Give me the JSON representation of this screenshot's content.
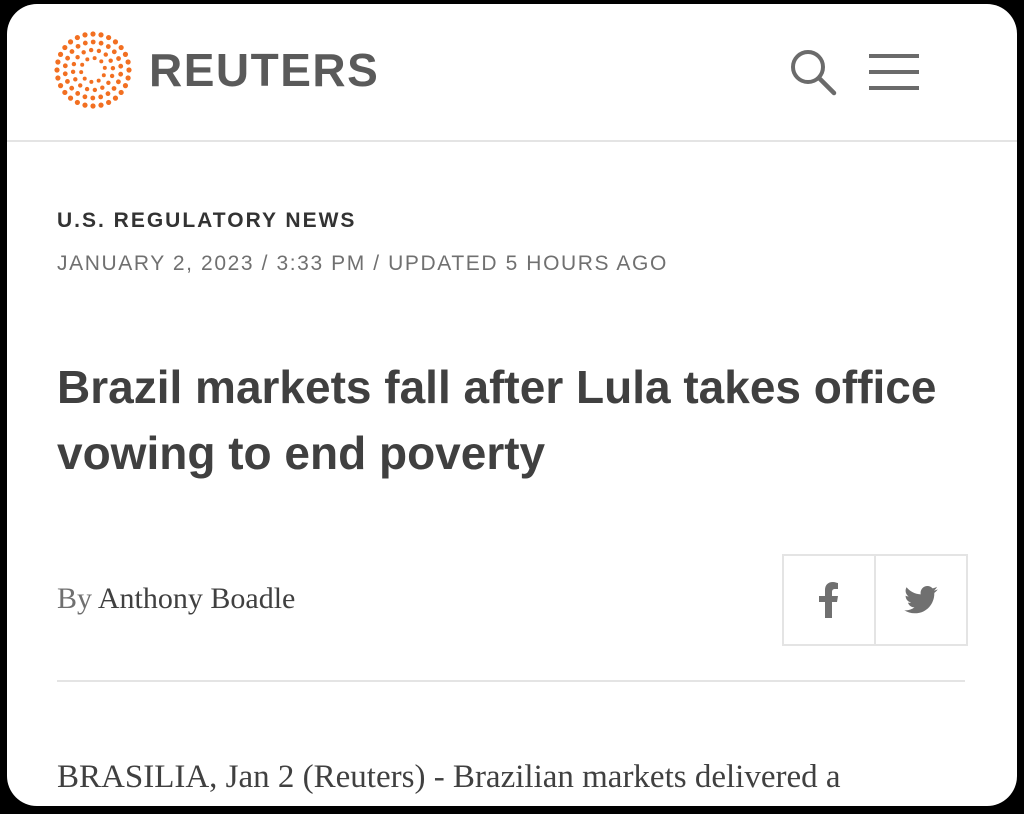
{
  "header": {
    "brand": "REUTERS",
    "logo_color": "#f26f21",
    "icons": [
      "reuters-logo-icon",
      "search-icon",
      "menu-icon"
    ]
  },
  "article": {
    "category": "U.S. REGULATORY NEWS",
    "dateline": "JANUARY 2, 2023 / 3:33 PM / UPDATED 5 HOURS AGO",
    "headline": "Brazil markets fall after Lula takes office vowing to end poverty",
    "byline_prefix": "By",
    "author": "Anthony Boadle",
    "lede": "BRASILIA, Jan 2 (Reuters) - Brazilian markets delivered a"
  },
  "share": {
    "icons": [
      "facebook-icon",
      "twitter-icon"
    ]
  }
}
